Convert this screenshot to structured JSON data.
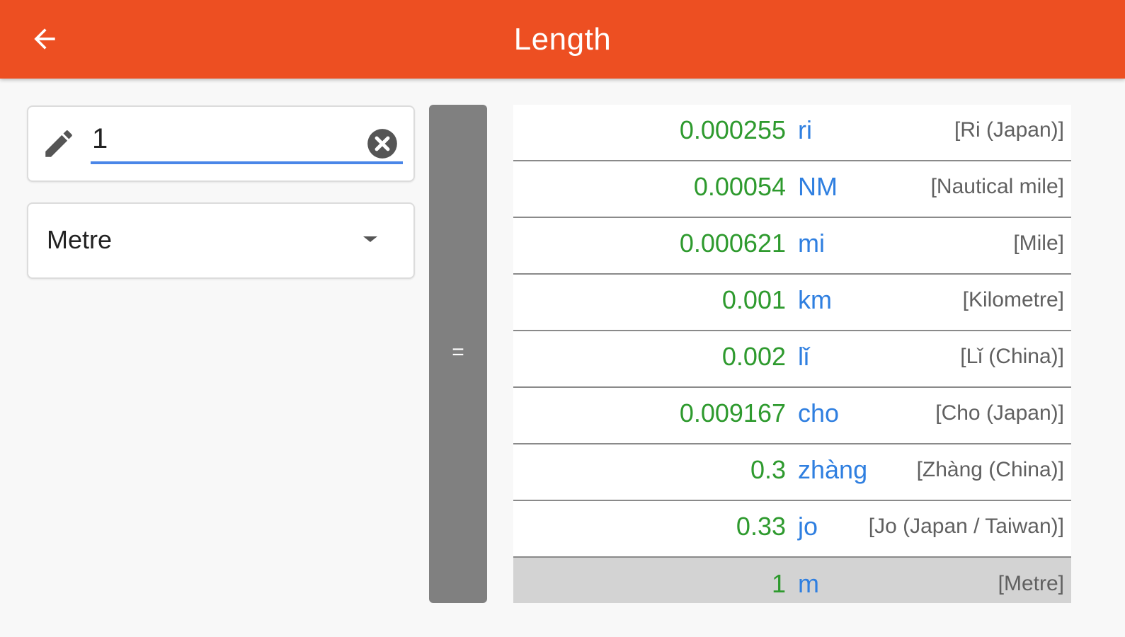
{
  "app_bar": {
    "title": "Length",
    "color": "#ed4f22"
  },
  "input": {
    "value": "1",
    "icon": "pencil-icon",
    "clear_icon": "clear-icon"
  },
  "unit_selector": {
    "selected": "Metre"
  },
  "equals": {
    "label": "="
  },
  "results": [
    {
      "value": "0.000255",
      "symbol": "ri",
      "name": "[Ri (Japan)]"
    },
    {
      "value": "0.00054",
      "symbol": "NM",
      "name": "[Nautical mile]"
    },
    {
      "value": "0.000621",
      "symbol": "mi",
      "name": "[Mile]"
    },
    {
      "value": "0.001",
      "symbol": "km",
      "name": "[Kilometre]"
    },
    {
      "value": "0.002",
      "symbol": "lǐ",
      "name": "[Lǐ (China)]"
    },
    {
      "value": "0.009167",
      "symbol": "cho",
      "name": "[Cho (Japan)]"
    },
    {
      "value": "0.3",
      "symbol": "zhàng",
      "name": "[Zhàng (China)]"
    },
    {
      "value": "0.33",
      "symbol": "jo",
      "name": "[Jo (Japan / Taiwan)]"
    },
    {
      "value": "1",
      "symbol": "m",
      "name": "[Metre]",
      "selected": true
    }
  ],
  "colors": {
    "value_green": "#2e9a2e",
    "symbol_blue": "#2f7fe0",
    "accent_underline": "#4a86e8",
    "equals_bar": "#808080",
    "selected_row": "#d3d3d3"
  }
}
